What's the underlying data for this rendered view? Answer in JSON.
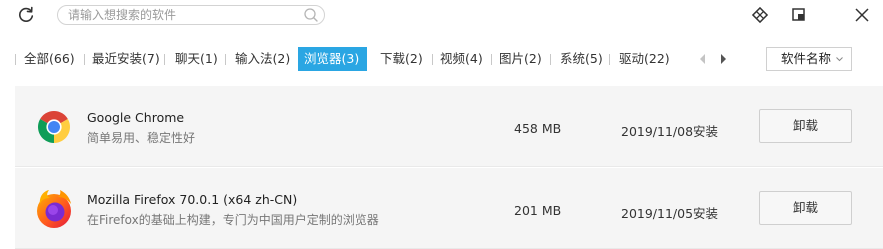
{
  "search": {
    "placeholder": "请输入想搜索的软件",
    "value": ""
  },
  "tabs": [
    {
      "label": "全部(66)",
      "active": false
    },
    {
      "label": "最近安装(7)",
      "active": false
    },
    {
      "label": "聊天(1)",
      "active": false
    },
    {
      "label": "输入法(2)",
      "active": false
    },
    {
      "label": "浏览器(3)",
      "active": true
    },
    {
      "label": "下载(2)",
      "active": false
    },
    {
      "label": "视频(4)",
      "active": false
    },
    {
      "label": "图片(2)",
      "active": false
    },
    {
      "label": "系统(5)",
      "active": false
    },
    {
      "label": "驱动(22)",
      "active": false
    }
  ],
  "sort": {
    "label": "软件名称"
  },
  "apps": [
    {
      "name": "Google Chrome",
      "desc": "简单易用、稳定性好",
      "size": "458 MB",
      "date": "2019/11/08安装",
      "action": "卸载",
      "icon": "chrome-icon"
    },
    {
      "name": "Mozilla Firefox 70.0.1 (x64 zh-CN)",
      "desc": "在Firefox的基础上构建，专门为中国用户定制的浏览器",
      "size": "201 MB",
      "date": "2019/11/05安装",
      "action": "卸载",
      "icon": "firefox-icon"
    }
  ],
  "colors": {
    "accent": "#2aa6e3",
    "row_bg": "#f5f5f5"
  }
}
